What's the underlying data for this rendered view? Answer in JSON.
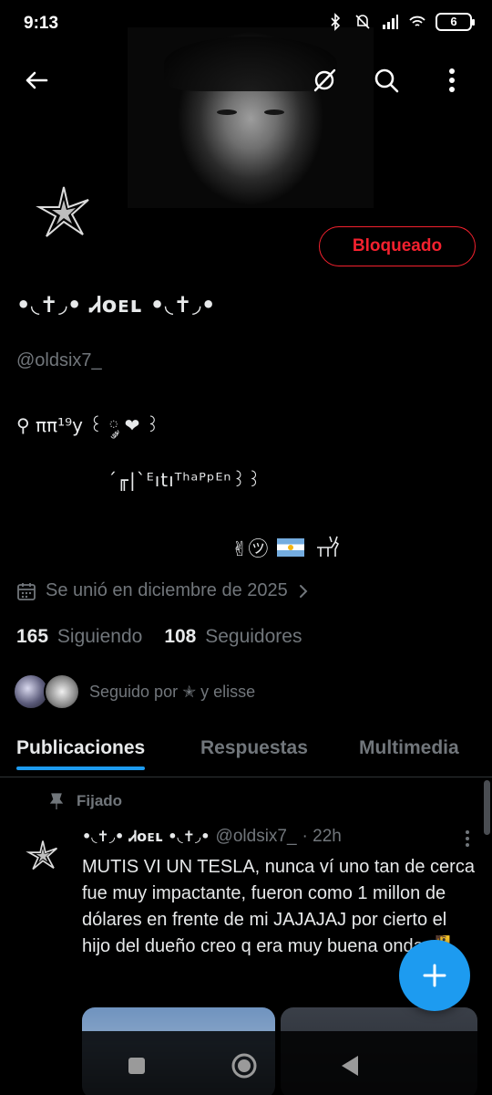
{
  "status_bar": {
    "time": "9:13",
    "battery": "6"
  },
  "profile": {
    "display_name": "•◟✝◞• Ꮧᴏᴇʟ •◟✝◞•",
    "handle": "@oldsix7_",
    "blocked_label": "Bloqueado",
    "bio_line1": "⚲ ππ¹⁹y ꒰ ༘ ❤ ꒱",
    "bio_line2": "´╓|`ᴱıtıᵀʰᵃᴾᵖᴱⁿ꒱꒱",
    "bio_line3_emojis": "✌︎㋡",
    "joined": "Se unió en diciembre de 2025",
    "following_count": "165",
    "following_label": "Siguiendo",
    "followers_count": "108",
    "followers_label": "Seguidores",
    "followed_by": "Seguido por ✭ y elisse"
  },
  "tabs": [
    {
      "label": "Publicaciones"
    },
    {
      "label": "Respuestas"
    },
    {
      "label": "Multimedia"
    }
  ],
  "post": {
    "pinned_label": "Fijado",
    "author_name": "•◟✝◞• Ꮧᴏᴇʟ •◟✝◞•",
    "author_handle": "@oldsix7_",
    "time": "· 22h",
    "text": "MUTIS VI UN TESLA, nunca ví uno tan de cerca fue muy impactante, fueron como 1 millon de dólares en frente de mi JAJAJAJ por cierto el hijo del dueño creo q era muy buena onda 🧏"
  },
  "colors": {
    "accent": "#1d9bf0",
    "danger": "#f4212e",
    "muted": "#71767b",
    "text": "#e7e9ea",
    "background": "#000000"
  }
}
